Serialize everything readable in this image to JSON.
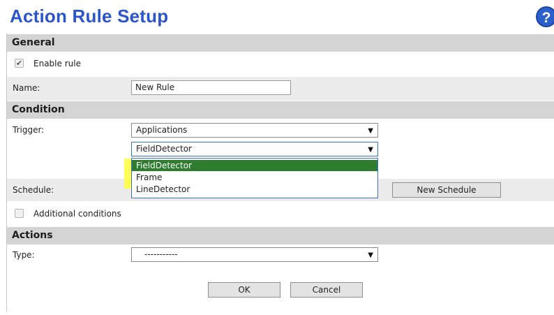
{
  "page": {
    "title": "Action Rule Setup",
    "help_icon_label": "?"
  },
  "general": {
    "header": "General",
    "enable_rule_label": "Enable rule",
    "enable_rule_checked": true,
    "name_label": "Name:",
    "name_value": "New Rule"
  },
  "condition": {
    "header": "Condition",
    "trigger_label": "Trigger:",
    "trigger_value": "Applications",
    "subtrigger_value": "FieldDetector",
    "dropdown_options": [
      "FieldDetector",
      "Frame",
      "LineDetector"
    ],
    "dropdown_selected_index": 0,
    "schedule_label": "Schedule:",
    "new_schedule_button": "New Schedule",
    "additional_conditions_label": "Additional conditions",
    "additional_conditions_checked": false
  },
  "actions": {
    "header": "Actions",
    "type_label": "Type:",
    "type_value": "-----------"
  },
  "footer": {
    "ok_label": "OK",
    "cancel_label": "Cancel"
  },
  "colors": {
    "title": "#2b55c9",
    "section_header_bg": "#d4d4d4",
    "selected_option_bg": "#2e7d2e",
    "highlight": "#ffff3c"
  },
  "icons": {
    "help": "help-icon",
    "dropdown_arrow": "triangle-down-icon",
    "check": "checkmark-icon"
  }
}
